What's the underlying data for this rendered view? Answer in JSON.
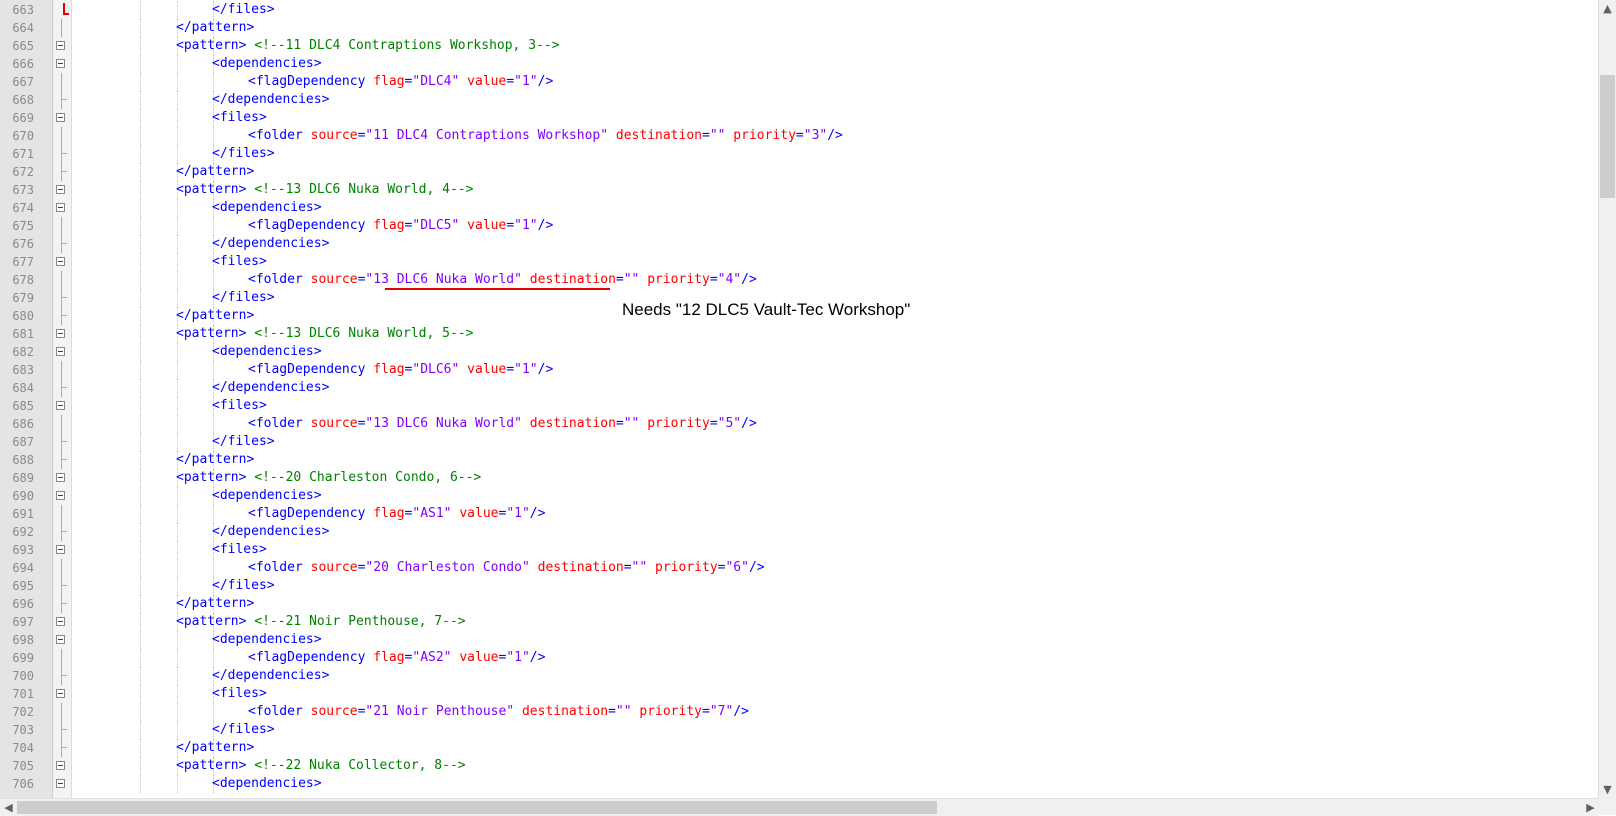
{
  "annotation": {
    "note": "Needs \"12 DLC5 Vault-Tec Workshop\""
  },
  "lines": [
    {
      "n": "663",
      "indent": 2,
      "fold": "none",
      "segs": [
        [
          "tag",
          "</files>"
        ]
      ]
    },
    {
      "n": "664",
      "indent": 1,
      "fold": "line",
      "segs": [
        [
          "tag",
          "</pattern>"
        ]
      ]
    },
    {
      "n": "665",
      "indent": 1,
      "fold": "box",
      "segs": [
        [
          "tag",
          "<pattern>"
        ],
        [
          "plain",
          " "
        ],
        [
          "cm",
          "<!--11 DLC4 Contraptions Workshop, 3-->"
        ]
      ]
    },
    {
      "n": "666",
      "indent": 2,
      "fold": "box",
      "segs": [
        [
          "tag",
          "<dependencies>"
        ]
      ]
    },
    {
      "n": "667",
      "indent": 3,
      "fold": "line",
      "segs": [
        [
          "tag",
          "<flagDependency"
        ],
        [
          "plain",
          " "
        ],
        [
          "attr",
          "flag"
        ],
        [
          "tag",
          "="
        ],
        [
          "val",
          "\"DLC4\""
        ],
        [
          "plain",
          " "
        ],
        [
          "attr",
          "value"
        ],
        [
          "tag",
          "="
        ],
        [
          "val",
          "\"1\""
        ],
        [
          "tag",
          "/>"
        ]
      ]
    },
    {
      "n": "668",
      "indent": 2,
      "fold": "end",
      "segs": [
        [
          "tag",
          "</dependencies>"
        ]
      ]
    },
    {
      "n": "669",
      "indent": 2,
      "fold": "box",
      "segs": [
        [
          "tag",
          "<files>"
        ]
      ]
    },
    {
      "n": "670",
      "indent": 3,
      "fold": "line",
      "segs": [
        [
          "tag",
          "<folder"
        ],
        [
          "plain",
          " "
        ],
        [
          "attr",
          "source"
        ],
        [
          "tag",
          "="
        ],
        [
          "val",
          "\"11 DLC4 Contraptions Workshop\""
        ],
        [
          "plain",
          " "
        ],
        [
          "attr",
          "destination"
        ],
        [
          "tag",
          "="
        ],
        [
          "val",
          "\"\""
        ],
        [
          "plain",
          " "
        ],
        [
          "attr",
          "priority"
        ],
        [
          "tag",
          "="
        ],
        [
          "val",
          "\"3\""
        ],
        [
          "tag",
          "/>"
        ]
      ]
    },
    {
      "n": "671",
      "indent": 2,
      "fold": "end",
      "segs": [
        [
          "tag",
          "</files>"
        ]
      ]
    },
    {
      "n": "672",
      "indent": 1,
      "fold": "end",
      "segs": [
        [
          "tag",
          "</pattern>"
        ]
      ]
    },
    {
      "n": "673",
      "indent": 1,
      "fold": "box",
      "segs": [
        [
          "tag",
          "<pattern>"
        ],
        [
          "plain",
          " "
        ],
        [
          "cm",
          "<!--13 DLC6 Nuka World, 4-->"
        ]
      ]
    },
    {
      "n": "674",
      "indent": 2,
      "fold": "box",
      "segs": [
        [
          "tag",
          "<dependencies>"
        ]
      ]
    },
    {
      "n": "675",
      "indent": 3,
      "fold": "line",
      "segs": [
        [
          "tag",
          "<flagDependency"
        ],
        [
          "plain",
          " "
        ],
        [
          "attr",
          "flag"
        ],
        [
          "tag",
          "="
        ],
        [
          "val",
          "\"DLC5\""
        ],
        [
          "plain",
          " "
        ],
        [
          "attr",
          "value"
        ],
        [
          "tag",
          "="
        ],
        [
          "val",
          "\"1\""
        ],
        [
          "tag",
          "/>"
        ]
      ]
    },
    {
      "n": "676",
      "indent": 2,
      "fold": "end",
      "segs": [
        [
          "tag",
          "</dependencies>"
        ]
      ]
    },
    {
      "n": "677",
      "indent": 2,
      "fold": "box",
      "segs": [
        [
          "tag",
          "<files>"
        ]
      ]
    },
    {
      "n": "678",
      "indent": 3,
      "fold": "line",
      "segs": [
        [
          "tag",
          "<folder"
        ],
        [
          "plain",
          " "
        ],
        [
          "attr",
          "source"
        ],
        [
          "tag",
          "="
        ],
        [
          "val",
          "\"13 DLC6 Nuka World\""
        ],
        [
          "plain",
          " "
        ],
        [
          "attr",
          "destination"
        ],
        [
          "tag",
          "="
        ],
        [
          "val",
          "\"\""
        ],
        [
          "plain",
          " "
        ],
        [
          "attr",
          "priority"
        ],
        [
          "tag",
          "="
        ],
        [
          "val",
          "\"4\""
        ],
        [
          "tag",
          "/>"
        ]
      ]
    },
    {
      "n": "679",
      "indent": 2,
      "fold": "end",
      "segs": [
        [
          "tag",
          "</files>"
        ]
      ]
    },
    {
      "n": "680",
      "indent": 1,
      "fold": "end",
      "segs": [
        [
          "tag",
          "</pattern>"
        ]
      ]
    },
    {
      "n": "681",
      "indent": 1,
      "fold": "box",
      "segs": [
        [
          "tag",
          "<pattern>"
        ],
        [
          "plain",
          " "
        ],
        [
          "cm",
          "<!--13 DLC6 Nuka World, 5-->"
        ]
      ]
    },
    {
      "n": "682",
      "indent": 2,
      "fold": "box",
      "segs": [
        [
          "tag",
          "<dependencies>"
        ]
      ]
    },
    {
      "n": "683",
      "indent": 3,
      "fold": "line",
      "segs": [
        [
          "tag",
          "<flagDependency"
        ],
        [
          "plain",
          " "
        ],
        [
          "attr",
          "flag"
        ],
        [
          "tag",
          "="
        ],
        [
          "val",
          "\"DLC6\""
        ],
        [
          "plain",
          " "
        ],
        [
          "attr",
          "value"
        ],
        [
          "tag",
          "="
        ],
        [
          "val",
          "\"1\""
        ],
        [
          "tag",
          "/>"
        ]
      ]
    },
    {
      "n": "684",
      "indent": 2,
      "fold": "end",
      "segs": [
        [
          "tag",
          "</dependencies>"
        ]
      ]
    },
    {
      "n": "685",
      "indent": 2,
      "fold": "box",
      "segs": [
        [
          "tag",
          "<files>"
        ]
      ]
    },
    {
      "n": "686",
      "indent": 3,
      "fold": "line",
      "segs": [
        [
          "tag",
          "<folder"
        ],
        [
          "plain",
          " "
        ],
        [
          "attr",
          "source"
        ],
        [
          "tag",
          "="
        ],
        [
          "val",
          "\"13 DLC6 Nuka World\""
        ],
        [
          "plain",
          " "
        ],
        [
          "attr",
          "destination"
        ],
        [
          "tag",
          "="
        ],
        [
          "val",
          "\"\""
        ],
        [
          "plain",
          " "
        ],
        [
          "attr",
          "priority"
        ],
        [
          "tag",
          "="
        ],
        [
          "val",
          "\"5\""
        ],
        [
          "tag",
          "/>"
        ]
      ]
    },
    {
      "n": "687",
      "indent": 2,
      "fold": "end",
      "segs": [
        [
          "tag",
          "</files>"
        ]
      ]
    },
    {
      "n": "688",
      "indent": 1,
      "fold": "end",
      "segs": [
        [
          "tag",
          "</pattern>"
        ]
      ]
    },
    {
      "n": "689",
      "indent": 1,
      "fold": "box",
      "segs": [
        [
          "tag",
          "<pattern>"
        ],
        [
          "plain",
          " "
        ],
        [
          "cm",
          "<!--20 Charleston Condo, 6-->"
        ]
      ]
    },
    {
      "n": "690",
      "indent": 2,
      "fold": "box",
      "segs": [
        [
          "tag",
          "<dependencies>"
        ]
      ]
    },
    {
      "n": "691",
      "indent": 3,
      "fold": "line",
      "segs": [
        [
          "tag",
          "<flagDependency"
        ],
        [
          "plain",
          " "
        ],
        [
          "attr",
          "flag"
        ],
        [
          "tag",
          "="
        ],
        [
          "val",
          "\"AS1\""
        ],
        [
          "plain",
          " "
        ],
        [
          "attr",
          "value"
        ],
        [
          "tag",
          "="
        ],
        [
          "val",
          "\"1\""
        ],
        [
          "tag",
          "/>"
        ]
      ]
    },
    {
      "n": "692",
      "indent": 2,
      "fold": "end",
      "segs": [
        [
          "tag",
          "</dependencies>"
        ]
      ]
    },
    {
      "n": "693",
      "indent": 2,
      "fold": "box",
      "segs": [
        [
          "tag",
          "<files>"
        ]
      ]
    },
    {
      "n": "694",
      "indent": 3,
      "fold": "line",
      "segs": [
        [
          "tag",
          "<folder"
        ],
        [
          "plain",
          " "
        ],
        [
          "attr",
          "source"
        ],
        [
          "tag",
          "="
        ],
        [
          "val",
          "\"20 Charleston Condo\""
        ],
        [
          "plain",
          " "
        ],
        [
          "attr",
          "destination"
        ],
        [
          "tag",
          "="
        ],
        [
          "val",
          "\"\""
        ],
        [
          "plain",
          " "
        ],
        [
          "attr",
          "priority"
        ],
        [
          "tag",
          "="
        ],
        [
          "val",
          "\"6\""
        ],
        [
          "tag",
          "/>"
        ]
      ]
    },
    {
      "n": "695",
      "indent": 2,
      "fold": "end",
      "segs": [
        [
          "tag",
          "</files>"
        ]
      ]
    },
    {
      "n": "696",
      "indent": 1,
      "fold": "end",
      "segs": [
        [
          "tag",
          "</pattern>"
        ]
      ]
    },
    {
      "n": "697",
      "indent": 1,
      "fold": "box",
      "segs": [
        [
          "tag",
          "<pattern>"
        ],
        [
          "plain",
          " "
        ],
        [
          "cm",
          "<!--21 Noir Penthouse, 7-->"
        ]
      ]
    },
    {
      "n": "698",
      "indent": 2,
      "fold": "box",
      "segs": [
        [
          "tag",
          "<dependencies>"
        ]
      ]
    },
    {
      "n": "699",
      "indent": 3,
      "fold": "line",
      "segs": [
        [
          "tag",
          "<flagDependency"
        ],
        [
          "plain",
          " "
        ],
        [
          "attr",
          "flag"
        ],
        [
          "tag",
          "="
        ],
        [
          "val",
          "\"AS2\""
        ],
        [
          "plain",
          " "
        ],
        [
          "attr",
          "value"
        ],
        [
          "tag",
          "="
        ],
        [
          "val",
          "\"1\""
        ],
        [
          "tag",
          "/>"
        ]
      ]
    },
    {
      "n": "700",
      "indent": 2,
      "fold": "end",
      "segs": [
        [
          "tag",
          "</dependencies>"
        ]
      ]
    },
    {
      "n": "701",
      "indent": 2,
      "fold": "box",
      "segs": [
        [
          "tag",
          "<files>"
        ]
      ]
    },
    {
      "n": "702",
      "indent": 3,
      "fold": "line",
      "segs": [
        [
          "tag",
          "<folder"
        ],
        [
          "plain",
          " "
        ],
        [
          "attr",
          "source"
        ],
        [
          "tag",
          "="
        ],
        [
          "val",
          "\"21 Noir Penthouse\""
        ],
        [
          "plain",
          " "
        ],
        [
          "attr",
          "destination"
        ],
        [
          "tag",
          "="
        ],
        [
          "val",
          "\"\""
        ],
        [
          "plain",
          " "
        ],
        [
          "attr",
          "priority"
        ],
        [
          "tag",
          "="
        ],
        [
          "val",
          "\"7\""
        ],
        [
          "tag",
          "/>"
        ]
      ]
    },
    {
      "n": "703",
      "indent": 2,
      "fold": "end",
      "segs": [
        [
          "tag",
          "</files>"
        ]
      ]
    },
    {
      "n": "704",
      "indent": 1,
      "fold": "end",
      "segs": [
        [
          "tag",
          "</pattern>"
        ]
      ]
    },
    {
      "n": "705",
      "indent": 1,
      "fold": "box",
      "segs": [
        [
          "tag",
          "<pattern>"
        ],
        [
          "plain",
          " "
        ],
        [
          "cm",
          "<!--22 Nuka Collector, 8-->"
        ]
      ]
    },
    {
      "n": "706",
      "indent": 2,
      "fold": "box",
      "segs": [
        [
          "tag",
          "<dependencies>"
        ]
      ]
    }
  ]
}
